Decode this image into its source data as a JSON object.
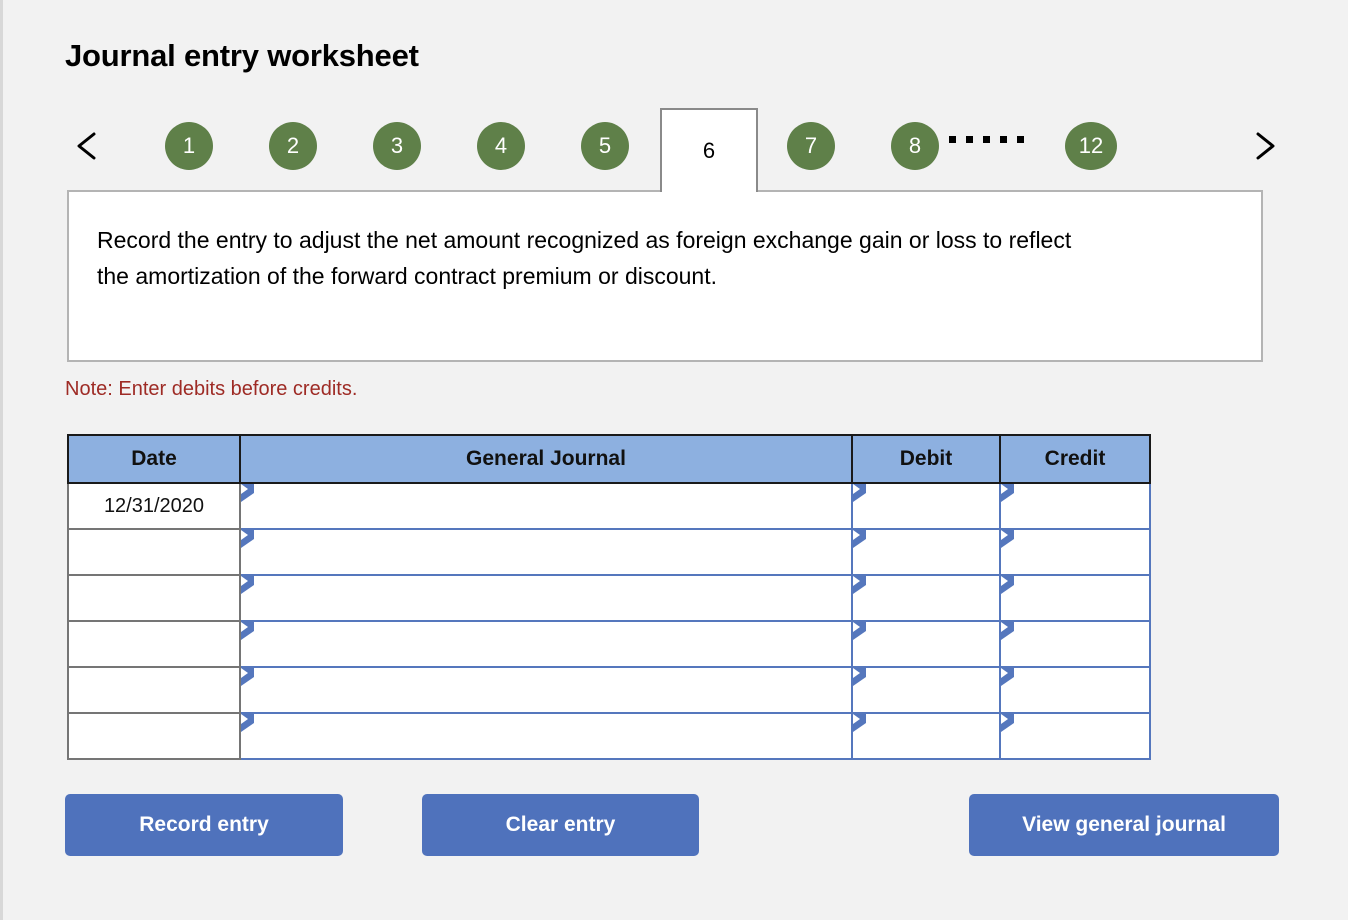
{
  "page": {
    "title": "Journal entry worksheet",
    "accent_green": "#5f8049",
    "accent_blue": "#4f72bc",
    "header_blue": "#8db0e0",
    "note_red": "#9e2b25",
    "background": "#f2f2f2"
  },
  "tabs": {
    "prev_icon": "chevron-left-icon",
    "next_icon": "chevron-right-icon",
    "items": [
      {
        "label": "1",
        "active": false
      },
      {
        "label": "2",
        "active": false
      },
      {
        "label": "3",
        "active": false
      },
      {
        "label": "4",
        "active": false
      },
      {
        "label": "5",
        "active": false
      },
      {
        "label": "6",
        "active": true
      },
      {
        "label": "7",
        "active": false
      },
      {
        "label": "8",
        "active": false
      },
      {
        "label": "12",
        "active": false
      }
    ],
    "ellipsis": "....."
  },
  "instruction": {
    "text": "Record the entry to adjust the net amount recognized as foreign exchange gain or loss to reflect the amortization of the forward contract premium or discount."
  },
  "note": "Note: Enter debits before credits.",
  "table": {
    "columns": [
      "Date",
      "General Journal",
      "Debit",
      "Credit"
    ],
    "rows": [
      {
        "date": "12/31/2020",
        "general_journal": "",
        "debit": "",
        "credit": ""
      },
      {
        "date": "",
        "general_journal": "",
        "debit": "",
        "credit": ""
      },
      {
        "date": "",
        "general_journal": "",
        "debit": "",
        "credit": ""
      },
      {
        "date": "",
        "general_journal": "",
        "debit": "",
        "credit": ""
      },
      {
        "date": "",
        "general_journal": "",
        "debit": "",
        "credit": ""
      },
      {
        "date": "",
        "general_journal": "",
        "debit": "",
        "credit": ""
      }
    ]
  },
  "actions": {
    "record": "Record entry",
    "clear": "Clear entry",
    "view": "View general journal"
  }
}
